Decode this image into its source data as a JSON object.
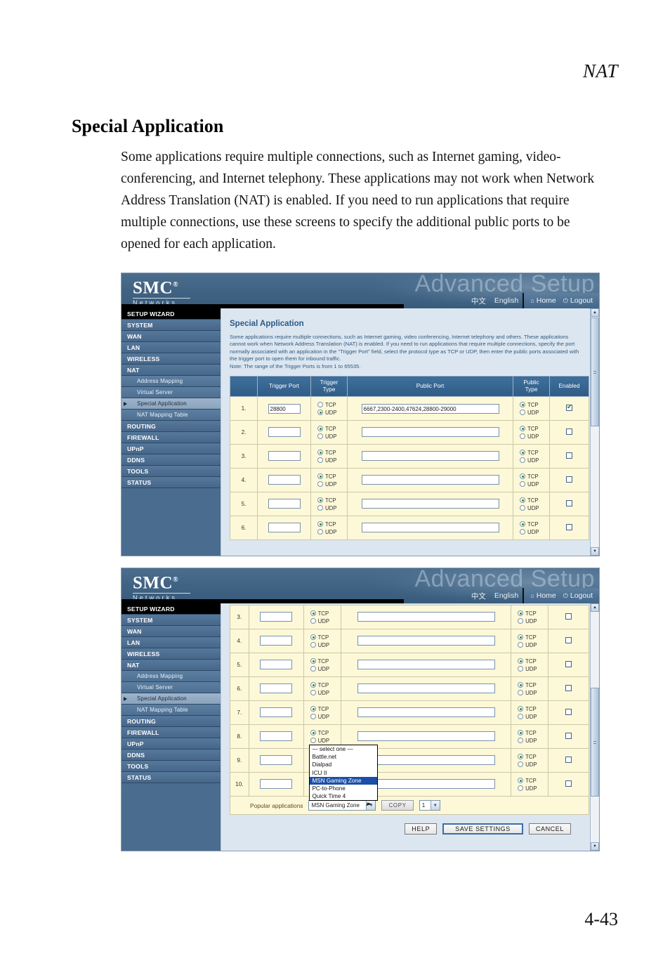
{
  "document": {
    "running_head": "NAT",
    "page_number": "4-43",
    "heading": "Special Application",
    "body": "Some applications require multiple connections, such as Internet gaming, video-conferencing, and Internet telephony. These applications may not work when Network Address Translation (NAT) is enabled. If you need to run applications that require multiple connections, use these screens to specify the additional public ports to be opened for each application."
  },
  "ui": {
    "brand": "SMC",
    "brand_sup": "®",
    "brand_sub": "Networks",
    "watermark": "Advanced Setup",
    "lang_zh": "中文",
    "lang_en": "English",
    "home": "Home",
    "logout": "Logout",
    "home_icon": "home-icon",
    "logout_icon": "power-icon",
    "scroll_up_icon": "▲",
    "scroll_down_icon": "▼"
  },
  "sidebar": {
    "items": [
      {
        "label": "SETUP WIZARD",
        "level": "top",
        "state": "first"
      },
      {
        "label": "SYSTEM",
        "level": "top",
        "state": ""
      },
      {
        "label": "WAN",
        "level": "top",
        "state": ""
      },
      {
        "label": "LAN",
        "level": "top",
        "state": ""
      },
      {
        "label": "WIRELESS",
        "level": "top",
        "state": ""
      },
      {
        "label": "NAT",
        "level": "top",
        "state": ""
      },
      {
        "label": "Address Mapping",
        "level": "sub",
        "state": ""
      },
      {
        "label": "Virtual Server",
        "level": "sub",
        "state": ""
      },
      {
        "label": "Special Application",
        "level": "sub",
        "state": "active"
      },
      {
        "label": "NAT Mapping Table",
        "level": "sub",
        "state": ""
      },
      {
        "label": "ROUTING",
        "level": "top",
        "state": ""
      },
      {
        "label": "FIREWALL",
        "level": "top",
        "state": ""
      },
      {
        "label": "UPnP",
        "level": "top",
        "state": ""
      },
      {
        "label": "DDNS",
        "level": "top",
        "state": ""
      },
      {
        "label": "TOOLS",
        "level": "top",
        "state": ""
      },
      {
        "label": "STATUS",
        "level": "top",
        "state": ""
      }
    ]
  },
  "panel": {
    "title": "Special Application",
    "description": "Some applications require multiple connections, such as Internet gaming, video conferencing, Internet telephony and others. These applications cannot work when Network Address Translation (NAT) is enabled. If you need to run applications that require multiple connections, specify the port normally associated with an application in the \"Trigger Port\" field, select the protocol type as TCP or UDP, then enter the public ports associated with the trigger port to open them for inbound traffic.",
    "note": "Note: The range of the Trigger Ports is from 1 to 65535.",
    "columns": [
      "",
      "Trigger Port",
      "Trigger Type",
      "Public Port",
      "Public Type",
      "Enabled"
    ],
    "proto_tcp": "TCP",
    "proto_udp": "UDP"
  },
  "screen1": {
    "rows": [
      {
        "index": "1.",
        "trigger_port": "28800",
        "trigger_type": "UDP",
        "public_port": "6667,2300-2400,47624,28800-29000",
        "public_type": "TCP",
        "enabled": true
      },
      {
        "index": "2.",
        "trigger_port": "",
        "trigger_type": "TCP",
        "public_port": "",
        "public_type": "TCP",
        "enabled": false
      },
      {
        "index": "3.",
        "trigger_port": "",
        "trigger_type": "TCP",
        "public_port": "",
        "public_type": "TCP",
        "enabled": false
      },
      {
        "index": "4.",
        "trigger_port": "",
        "trigger_type": "TCP",
        "public_port": "",
        "public_type": "TCP",
        "enabled": false
      },
      {
        "index": "5.",
        "trigger_port": "",
        "trigger_type": "TCP",
        "public_port": "",
        "public_type": "TCP",
        "enabled": false
      },
      {
        "index": "6.",
        "trigger_port": "",
        "trigger_type": "TCP",
        "public_port": "",
        "public_type": "TCP",
        "enabled": false
      }
    ]
  },
  "screen2": {
    "rows": [
      {
        "index": "3.",
        "trigger_port": "",
        "trigger_type": "TCP",
        "public_port": "",
        "public_type": "TCP",
        "enabled": false
      },
      {
        "index": "4.",
        "trigger_port": "",
        "trigger_type": "TCP",
        "public_port": "",
        "public_type": "TCP",
        "enabled": false
      },
      {
        "index": "5.",
        "trigger_port": "",
        "trigger_type": "TCP",
        "public_port": "",
        "public_type": "TCP",
        "enabled": false
      },
      {
        "index": "6.",
        "trigger_port": "",
        "trigger_type": "TCP",
        "public_port": "",
        "public_type": "TCP",
        "enabled": false
      },
      {
        "index": "7.",
        "trigger_port": "",
        "trigger_type": "TCP",
        "public_port": "",
        "public_type": "TCP",
        "enabled": false
      },
      {
        "index": "8.",
        "trigger_port": "",
        "trigger_type": "TCP",
        "public_port": "",
        "public_type": "TCP",
        "enabled": false
      },
      {
        "index": "9.",
        "trigger_port": "",
        "trigger_type": "TCP",
        "public_port": "",
        "public_type": "TCP",
        "enabled": false
      },
      {
        "index": "10.",
        "trigger_port": "",
        "trigger_type": "TCP",
        "public_port": "",
        "public_type": "TCP",
        "enabled": false
      }
    ],
    "popular_label": "Popular applications",
    "popular_selected": "MSN Gaming Zone",
    "popular_options": [
      "— select one —",
      "Battle.net",
      "Dialpad",
      "ICU II",
      "MSN Gaming Zone",
      "PC-to-Phone",
      "Quick Time 4"
    ],
    "copy_label": "COPY",
    "copy_target": "1",
    "buttons": {
      "help": "HELP",
      "save": "SAVE SETTINGS",
      "cancel": "CANCEL"
    }
  },
  "colors": {
    "header_blue": "#3f6182",
    "sidebar_blue": "#4a6d8f",
    "panel_bg": "#dce6f0",
    "row_yellow": "#fdf8d8",
    "th_blue": "#2f5c86",
    "title_blue": "#2c5a86",
    "highlight_blue": "#1b4fa8"
  }
}
